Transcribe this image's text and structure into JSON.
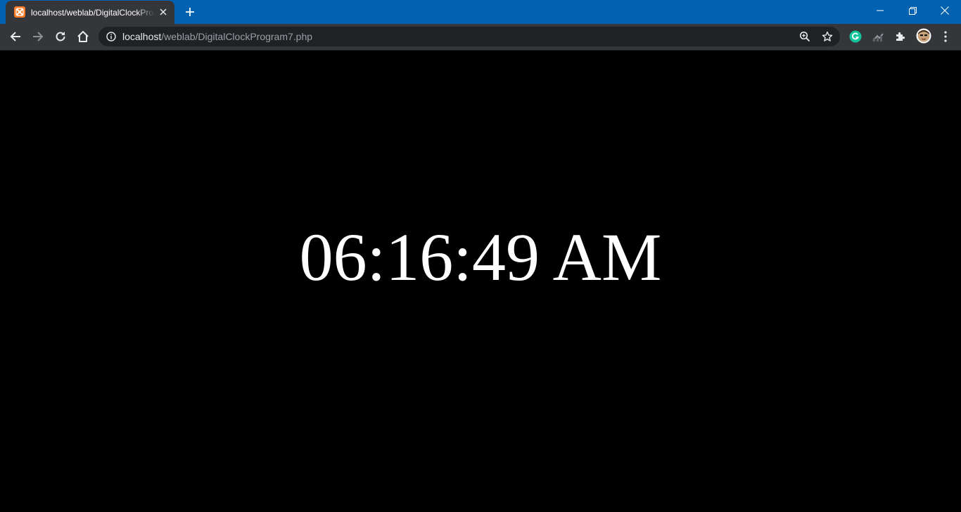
{
  "tab": {
    "title": "localhost/weblab/DigitalClockProgram7.php",
    "favicon": "xampp-logo-icon"
  },
  "address_bar": {
    "host": "localhost",
    "path": "/weblab/DigitalClockProgram7.php"
  },
  "icons": {
    "back": "arrow-left-icon",
    "forward": "arrow-right-icon",
    "reload": "reload-icon",
    "home": "home-icon",
    "info": "info-icon",
    "zoom": "zoom-icon",
    "bookmark": "star-icon",
    "extensions": [
      "grammarly-icon",
      "performance-icon",
      "puzzle-icon",
      "profile-avatar",
      "menu-kebab-icon"
    ]
  },
  "colors": {
    "titlebar": "#0062b1",
    "tab_active": "#35363a",
    "omnibox": "#202124",
    "page_background": "#000000",
    "clock_text": "#ffffff",
    "favicon": "#fb7a24",
    "grammarly": "#15c39a"
  },
  "page": {
    "clock_text": "06:16:49 AM"
  }
}
